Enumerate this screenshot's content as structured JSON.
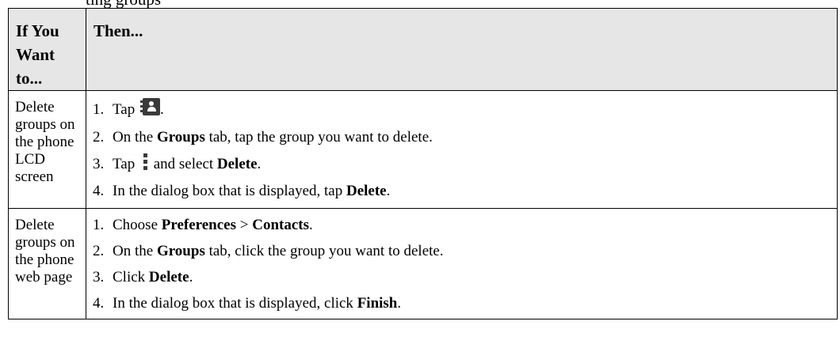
{
  "fragment": "ting groups",
  "table": {
    "header": {
      "col1": "If You Want to...",
      "col2": "Then..."
    },
    "rows": [
      {
        "condition": "Delete groups on the phone LCD screen",
        "steps": [
          {
            "num": "1.",
            "t1": "Tap ",
            "icon": "contacts-icon",
            "t2": "."
          },
          {
            "num": "2.",
            "t1": "On the ",
            "b1": "Groups",
            "t2": " tab, tap the group you want to delete."
          },
          {
            "num": "3.",
            "t1": "Tap ",
            "icon": "more-menu-icon",
            "t2": " and select ",
            "b1": "Delete",
            "t3": "."
          },
          {
            "num": "4.",
            "t1": "In the dialog box that is displayed, tap ",
            "b1": "Delete",
            "t2": "."
          }
        ]
      },
      {
        "condition": "Delete groups on the phone web page",
        "steps": [
          {
            "num": "1.",
            "t1": "Choose ",
            "b1": "Preferences",
            "t2": " > ",
            "b2": "Contacts",
            "t3": "."
          },
          {
            "num": "2.",
            "t1": "On the ",
            "b1": "Groups",
            "t2": " tab, click the group you want to delete."
          },
          {
            "num": "3.",
            "t1": "Click ",
            "b1": "Delete",
            "t2": "."
          },
          {
            "num": "4.",
            "t1": "In the dialog box that is displayed, click ",
            "b1": "Finish",
            "t2": "."
          }
        ]
      }
    ]
  }
}
